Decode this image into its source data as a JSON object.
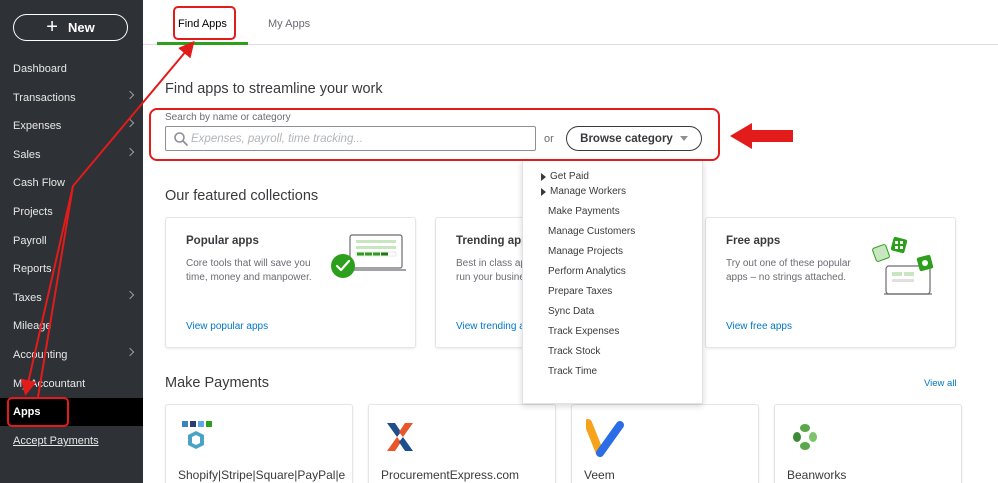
{
  "sidebar": {
    "new_label": "New",
    "items": [
      {
        "label": "Dashboard"
      },
      {
        "label": "Transactions"
      },
      {
        "label": "Expenses"
      },
      {
        "label": "Sales"
      },
      {
        "label": "Cash Flow"
      },
      {
        "label": "Projects"
      },
      {
        "label": "Payroll"
      },
      {
        "label": "Reports"
      },
      {
        "label": "Taxes"
      },
      {
        "label": "Mileage"
      },
      {
        "label": "Accounting"
      },
      {
        "label": "My Accountant"
      },
      {
        "label": "Apps"
      },
      {
        "label": "Accept Payments"
      }
    ]
  },
  "tabs": {
    "find": "Find Apps",
    "my": "My Apps"
  },
  "main": {
    "title": "Find apps to streamline your work",
    "search_label": "Search by name or category",
    "search_placeholder": "Expenses, payroll, time tracking...",
    "or": "or",
    "browse_label": "Browse category",
    "featured_title": "Our featured collections"
  },
  "featured": [
    {
      "title": "Popular apps",
      "desc1": "Core tools that will save you",
      "desc2": "time, money and manpower.",
      "link": "View popular apps"
    },
    {
      "title": "Trending apps",
      "desc1": "Best in class apps to help",
      "desc2": "run your business",
      "link": "View trending apps"
    },
    {
      "title": "Free apps",
      "desc1": "Try out one of these popular",
      "desc2": "apps – no strings attached.",
      "link": "View free apps"
    }
  ],
  "make_payments": {
    "title": "Make Payments",
    "view_all": "View all",
    "apps": [
      {
        "name": "Shopify|Stripe|Square|PayPal|e"
      },
      {
        "name": "ProcurementExpress.com"
      },
      {
        "name": "Veem"
      },
      {
        "name": "Beanworks"
      }
    ]
  },
  "dropdown": {
    "items": [
      {
        "label": "Get Paid"
      },
      {
        "label": "Manage Workers"
      },
      {
        "label": "Make Payments"
      },
      {
        "label": "Manage Customers"
      },
      {
        "label": "Manage Projects"
      },
      {
        "label": "Perform Analytics"
      },
      {
        "label": "Prepare Taxes"
      },
      {
        "label": "Sync Data"
      },
      {
        "label": "Track Expenses"
      },
      {
        "label": "Track Stock"
      },
      {
        "label": "Track Time"
      }
    ]
  },
  "colors": {
    "accent_green": "#2ca01c",
    "annotation_red": "#e21b1b",
    "link_blue": "#0077c5",
    "sidebar_bg": "#2e3135"
  }
}
